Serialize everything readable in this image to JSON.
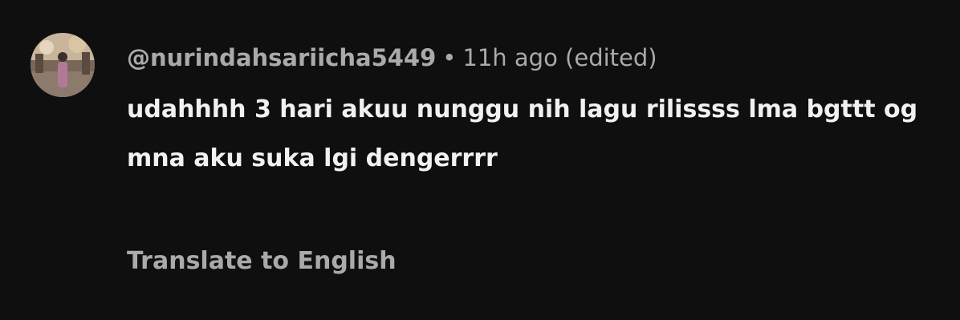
{
  "comment": {
    "author": "@nurindahsariicha5449",
    "separator": "•",
    "timestamp": "11h ago",
    "edited_label": "(edited)",
    "text": "udahhhh 3 hari akuu nunggu nih lagu rilissss lma bgttt og mna aku suka lgi dengerrrr",
    "translate_label": "Translate to English"
  },
  "colors": {
    "background": "#0f0f0f",
    "text_primary": "#f1f1f1",
    "text_secondary": "#aaaaaa"
  }
}
